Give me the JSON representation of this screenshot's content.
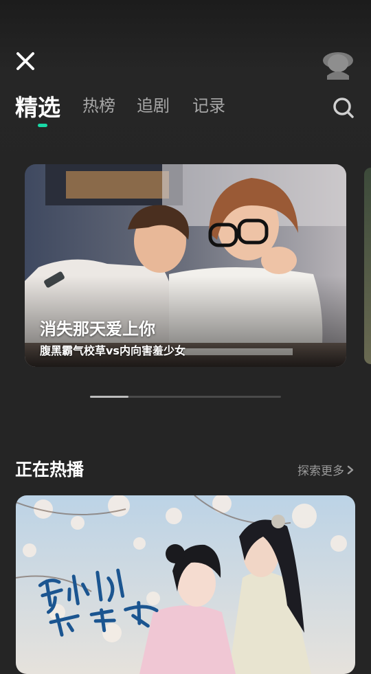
{
  "header": {
    "close_icon": "close-icon",
    "avatar_icon": "avatar-icon",
    "search_icon": "search-icon"
  },
  "tabs": [
    {
      "label": "精选",
      "active": true
    },
    {
      "label": "热榜",
      "active": false
    },
    {
      "label": "追剧",
      "active": false
    },
    {
      "label": "记录",
      "active": false
    }
  ],
  "colors": {
    "accent": "#19d9a6",
    "background": "#252525",
    "inactive_tab": "#a7a7a7"
  },
  "banner": {
    "title": "消失那天爱上你",
    "subtitle": "腹黑霸气校草vs内向害羞少女"
  },
  "carousel": {
    "current_page": 1,
    "progress_fraction": 0.2
  },
  "section": {
    "title": "正在热播",
    "more_label": "探索更多",
    "more_icon": "chevron-right-icon"
  },
  "poster": {
    "calligraphy": "苏小姐 請留步"
  }
}
